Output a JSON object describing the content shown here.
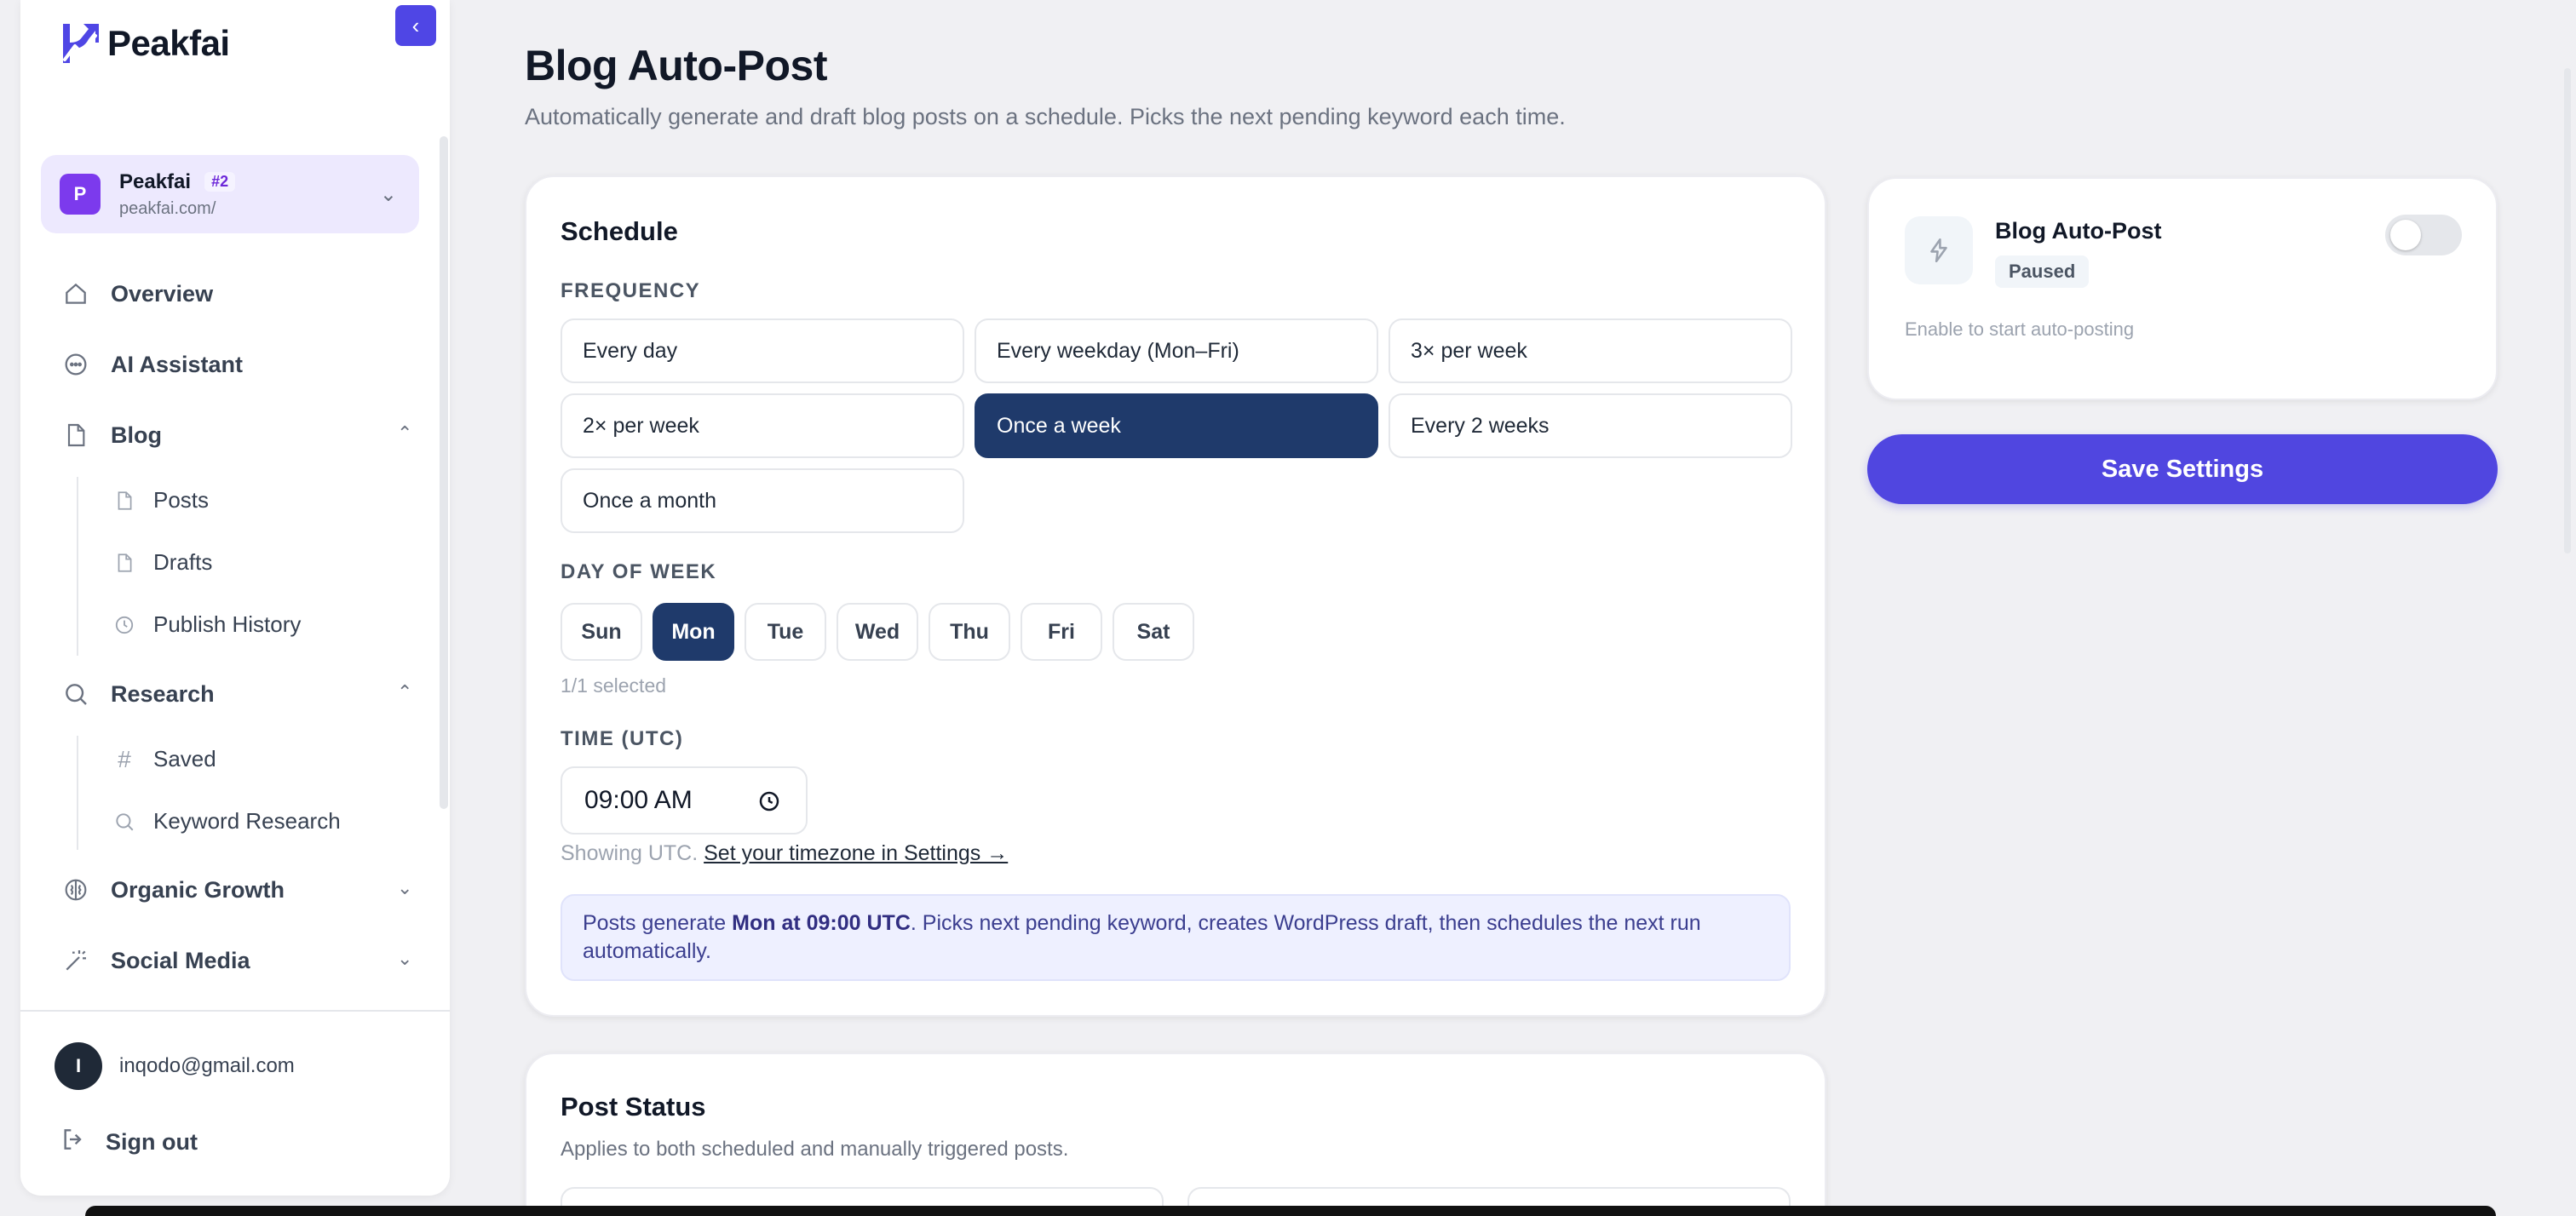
{
  "brand": {
    "name": "Peakfai",
    "accent": "#4f46e5"
  },
  "sidebar": {
    "collapse_icon": "chevron-left-icon",
    "project": {
      "avatar_letter": "P",
      "name": "Peakfai",
      "badge": "#2",
      "url": "peakfai.com/"
    },
    "nav": {
      "overview": "Overview",
      "ai_assistant": "AI Assistant",
      "blog": "Blog",
      "blog_posts": "Posts",
      "blog_drafts": "Drafts",
      "blog_history": "Publish History",
      "research": "Research",
      "research_saved": "Saved",
      "research_keyword": "Keyword Research",
      "organic_growth": "Organic Growth",
      "social_media": "Social Media"
    },
    "user": {
      "avatar_letter": "I",
      "email": "inqodo@gmail.com"
    },
    "sign_out": "Sign out"
  },
  "page": {
    "title": "Blog Auto-Post",
    "subtitle": "Automatically generate and draft blog posts on a schedule. Picks the next pending keyword each time."
  },
  "schedule": {
    "title": "Schedule",
    "frequency_label": "FREQUENCY",
    "frequency_options": [
      "Every day",
      "Every weekday (Mon–Fri)",
      "3× per week",
      "2× per week",
      "Once a week",
      "Every 2 weeks",
      "Once a month"
    ],
    "frequency_selected": "Once a week",
    "day_label": "DAY OF WEEK",
    "days": [
      "Sun",
      "Mon",
      "Tue",
      "Wed",
      "Thu",
      "Fri",
      "Sat"
    ],
    "day_selected": "Mon",
    "day_count": "1/1 selected",
    "time_label": "TIME (UTC)",
    "time_value": "09:00 AM",
    "tz_prefix": "Showing UTC.",
    "tz_link": "Set your timezone in Settings →",
    "info_prefix": "Posts generate ",
    "info_strong": "Mon at 09:00 UTC",
    "info_suffix": ". Picks next pending keyword, creates WordPress draft, then schedules the next run automatically."
  },
  "post_status": {
    "title": "Post Status",
    "subtitle": "Applies to both scheduled and manually triggered posts."
  },
  "autopost": {
    "title": "Blog Auto-Post",
    "status": "Paused",
    "hint": "Enable to start auto-posting",
    "enabled": false
  },
  "save_label": "Save Settings",
  "colors": {
    "primary": "#5046e0",
    "selected": "#1f3a6b",
    "info_bg": "#eef0ff"
  }
}
